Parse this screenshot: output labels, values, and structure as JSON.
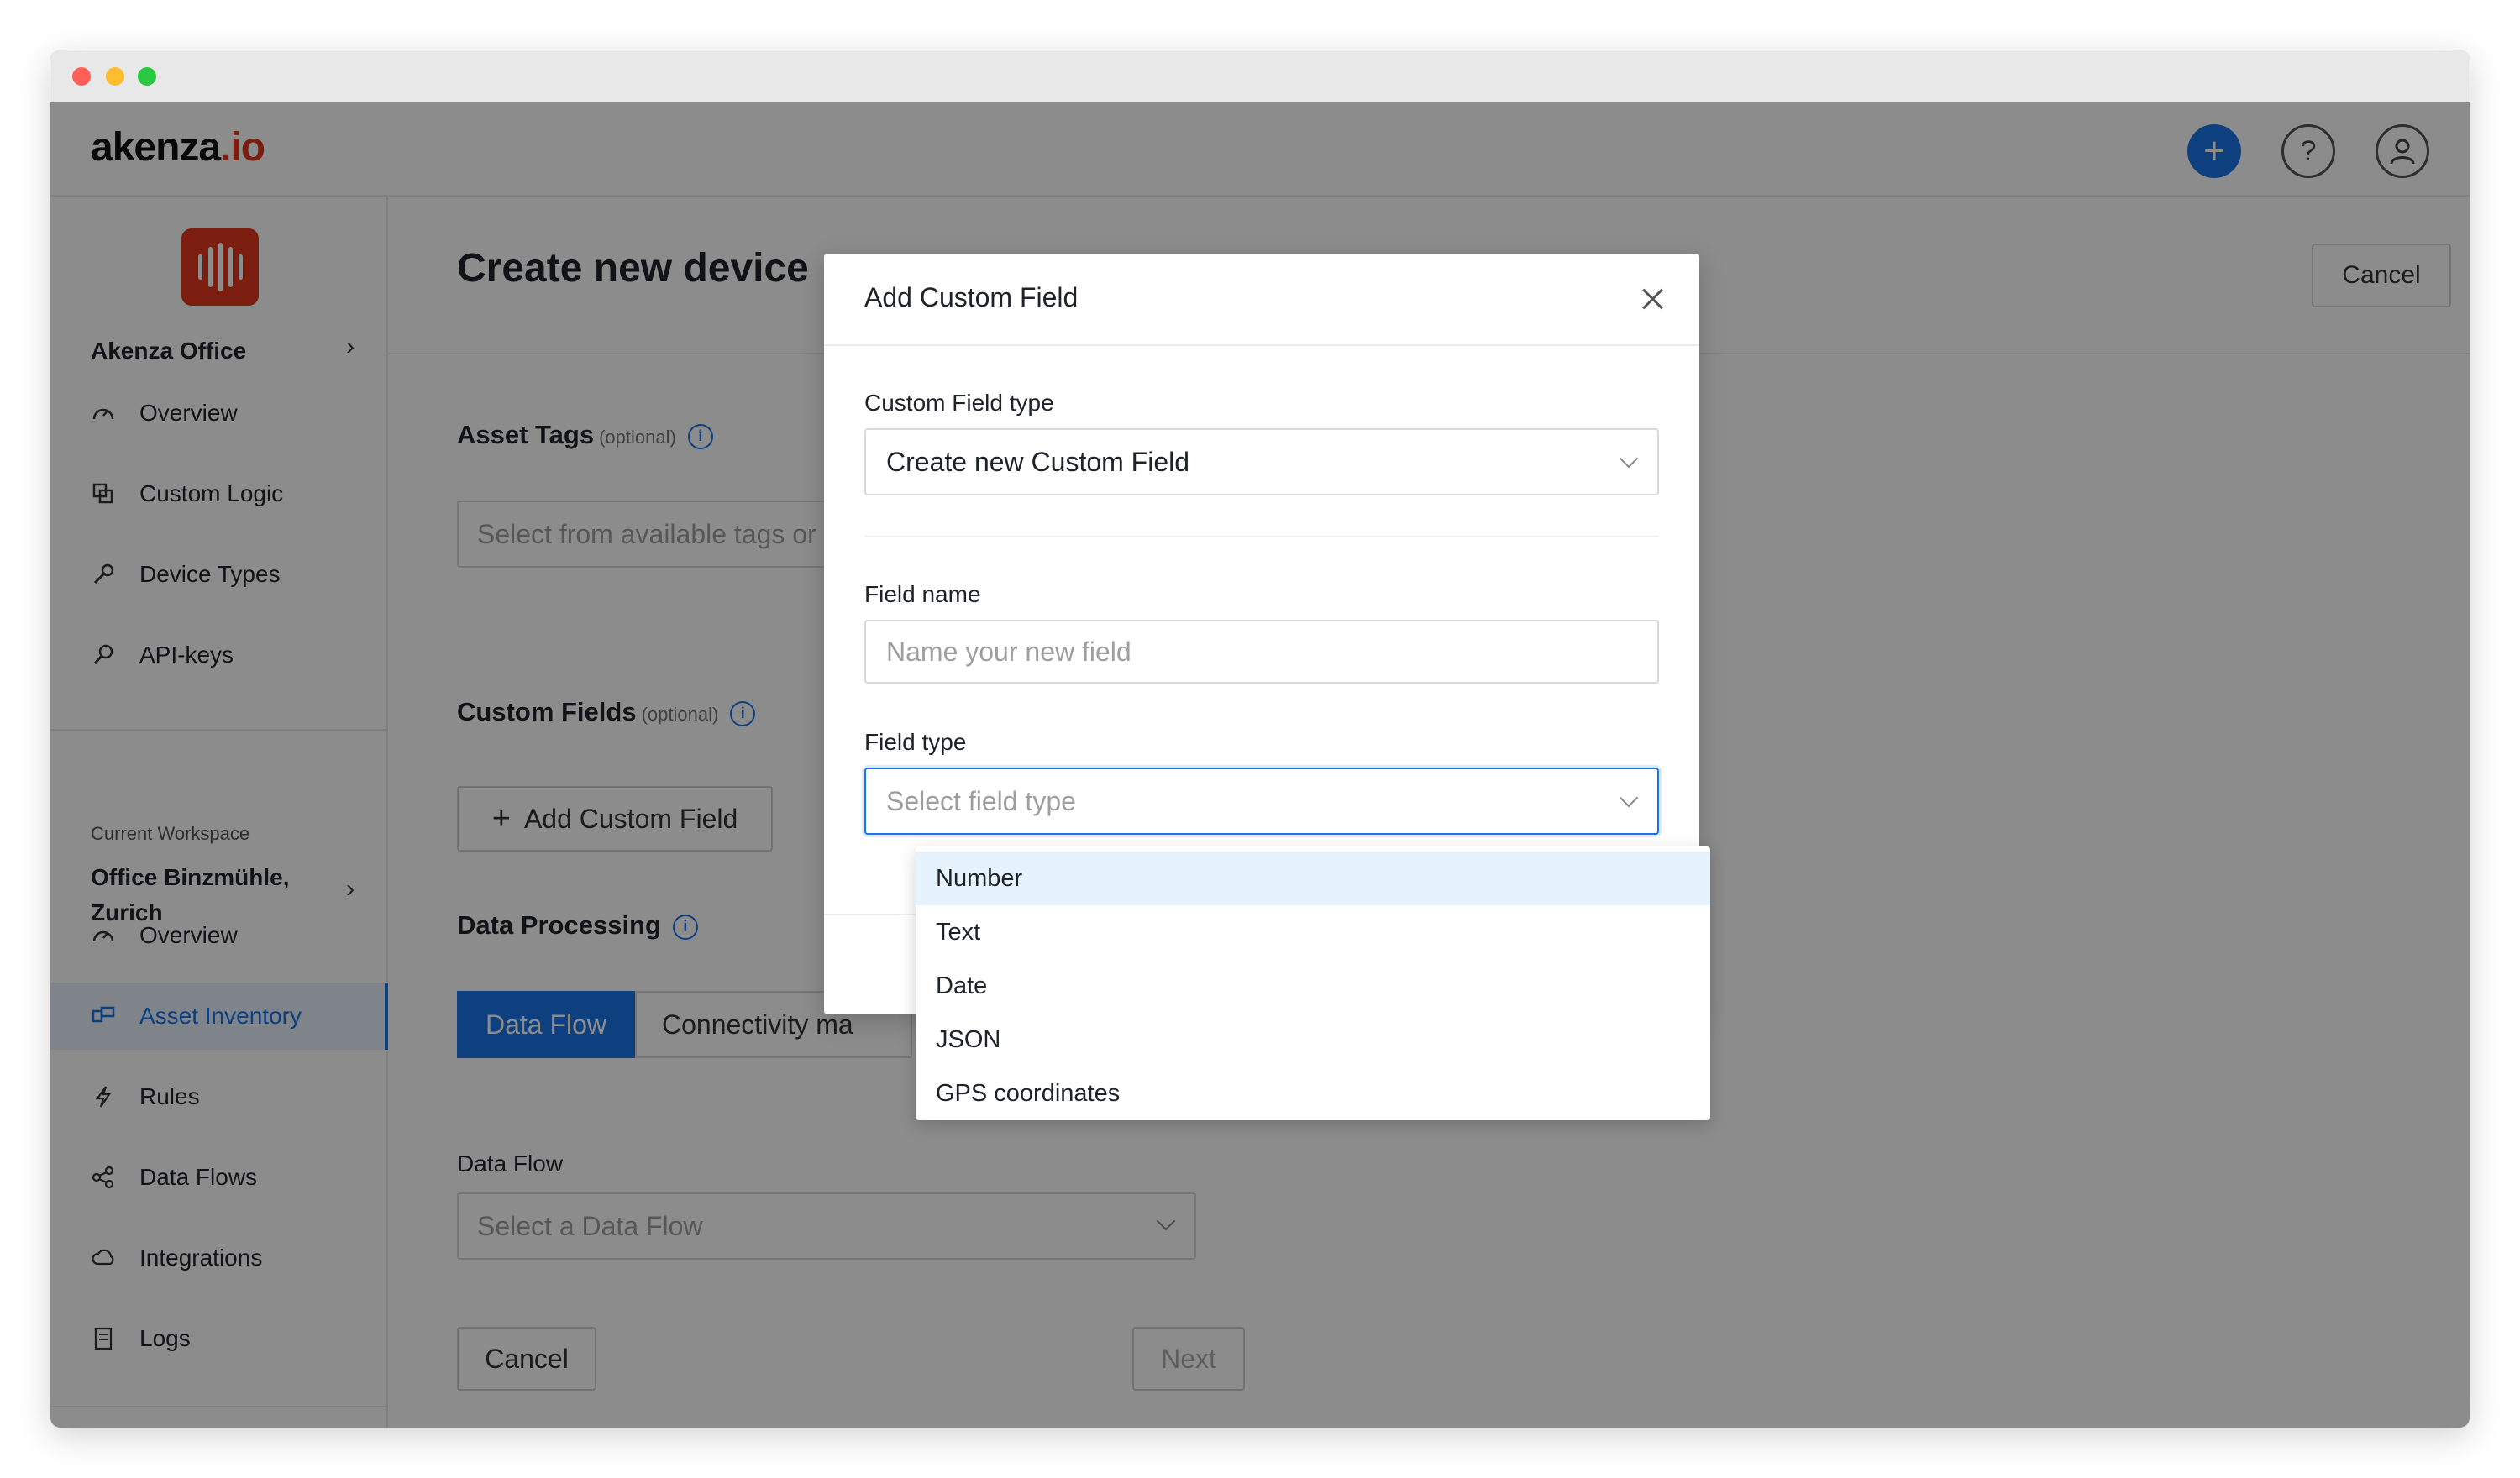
{
  "brand": {
    "logo_main": "akenza",
    "logo_suffix": ".io"
  },
  "topbar": {
    "add_icon": "plus-icon",
    "help_icon": "question-icon",
    "user_icon": "user-icon"
  },
  "sidebar": {
    "org_name": "Akenza Office",
    "org_items": [
      {
        "label": "Overview",
        "icon": "dashboard-icon"
      },
      {
        "label": "Custom Logic",
        "icon": "copy-icon"
      },
      {
        "label": "Device Types",
        "icon": "wrench-icon"
      },
      {
        "label": "API-keys",
        "icon": "key-icon"
      }
    ],
    "workspace_label": "Current Workspace",
    "workspace_name": "Office Binzmühle, Zurich",
    "workspace_items": [
      {
        "label": "Overview",
        "icon": "dashboard-icon"
      },
      {
        "label": "Asset Inventory",
        "icon": "inventory-icon",
        "active": true
      },
      {
        "label": "Rules",
        "icon": "bolt-icon"
      },
      {
        "label": "Data Flows",
        "icon": "share-icon"
      },
      {
        "label": "Integrations",
        "icon": "cloud-icon"
      },
      {
        "label": "Logs",
        "icon": "log-icon"
      }
    ]
  },
  "main": {
    "title": "Create new device",
    "cancel_label": "Cancel",
    "asset_tags": {
      "title": "Asset Tags",
      "optional": "(optional)",
      "placeholder": "Select from available tags or"
    },
    "custom_fields": {
      "title": "Custom Fields",
      "optional": "(optional)",
      "add_label": "Add Custom Field"
    },
    "data_processing": {
      "title": "Data Processing",
      "tabs": [
        "Data Flow",
        "Connectivity ma"
      ],
      "data_flow_label": "Data Flow",
      "data_flow_placeholder": "Select a Data Flow"
    },
    "footer": {
      "cancel_label": "Cancel",
      "next_label": "Next"
    }
  },
  "modal": {
    "title": "Add Custom Field",
    "custom_field_type_label": "Custom Field type",
    "custom_field_type_value": "Create new Custom Field",
    "field_name_label": "Field name",
    "field_name_placeholder": "Name your new field",
    "field_type_label": "Field type",
    "field_type_placeholder": "Select field type",
    "field_type_options": [
      "Number",
      "Text",
      "Date",
      "JSON",
      "GPS coordinates"
    ],
    "highlighted_option": "Number"
  },
  "colors": {
    "primary": "#1a73e8",
    "brand_red": "#e0361c",
    "highlight": "#e6f3fc"
  }
}
